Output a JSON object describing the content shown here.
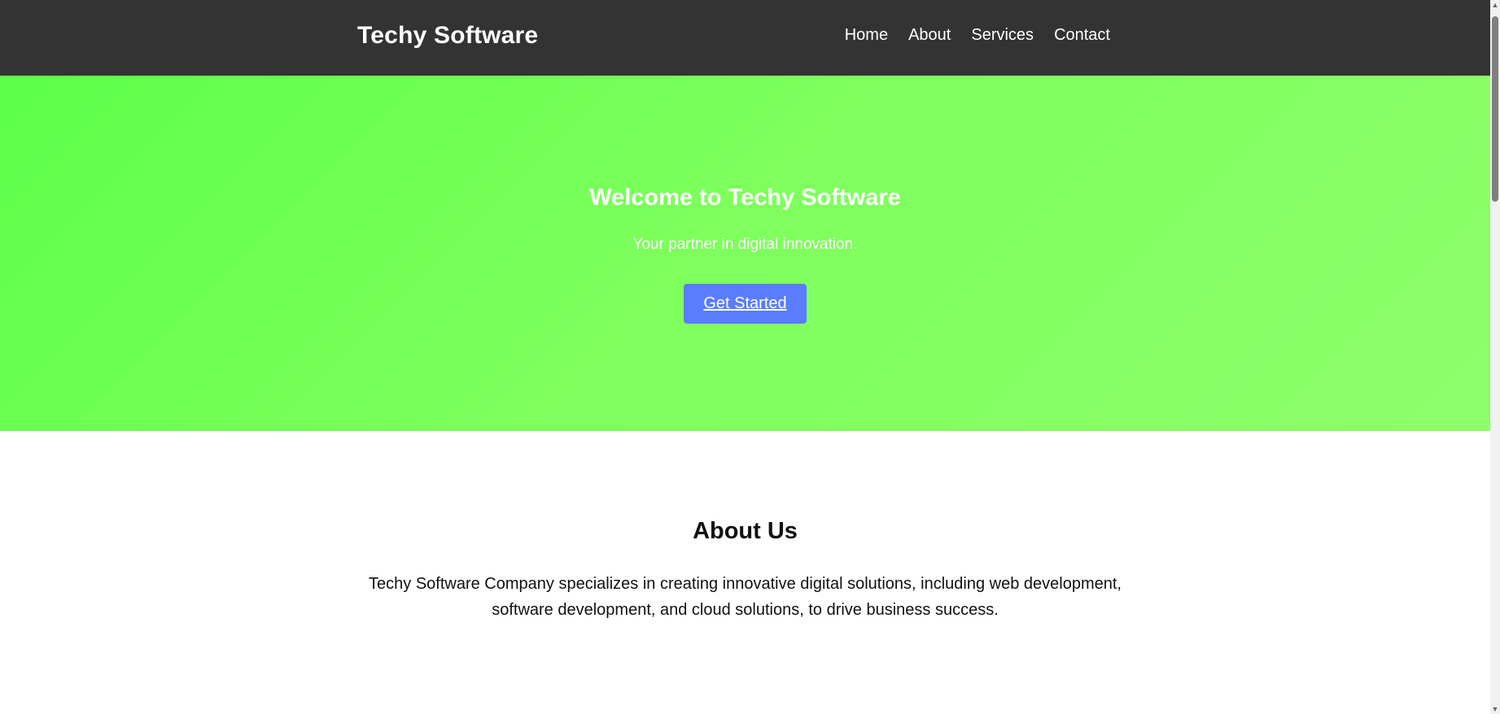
{
  "header": {
    "brand": "Techy Software",
    "nav": {
      "home": "Home",
      "about": "About",
      "services": "Services",
      "contact": "Contact"
    }
  },
  "hero": {
    "title": "Welcome to Techy Software",
    "subtitle": "Your partner in digital innovation.",
    "cta": "Get Started"
  },
  "about": {
    "title": "About Us",
    "text": "Techy Software Company specializes in creating innovative digital solutions, including web development, software development, and cloud solutions, to drive business success."
  },
  "colors": {
    "header_bg": "#333333",
    "hero_gradient_start": "#5cff4a",
    "hero_gradient_end": "#8dff6a",
    "cta_bg": "#5a7cff"
  },
  "icons": {
    "scroll_up": "▲",
    "scroll_down": "▼"
  }
}
